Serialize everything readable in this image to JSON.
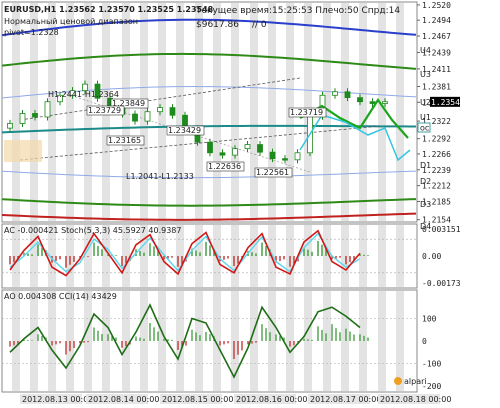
{
  "header": {
    "symbol_line": "EURUSD,H1  1.23562 1.23570 1.23525 1.23548",
    "subtitle_1": "Нормальный ценовой диапазон",
    "subtitle_2": "pivot=1.2328",
    "server_time": "Текущее время:15:25:53 Плечо:50 Спрд:14",
    "balance": "$9617.86",
    "slash_zero": "// 0"
  },
  "chart_data": [
    {
      "type": "line",
      "panel": "price",
      "y_ticks": [
        "1.2520",
        "1.2494",
        "1.2467",
        "1.2439",
        "1.2411",
        "1.2381",
        "1.2354",
        "1.2322",
        "1.2292",
        "1.2266",
        "1.2239",
        "1.2212",
        "1.2185",
        "1.2154"
      ],
      "current_price": "1.23548",
      "levels": [
        {
          "name": "U4",
          "value": 1.2494
        },
        {
          "name": "U3",
          "value": 1.2462
        },
        {
          "name": "U2",
          "value": 1.2415
        },
        {
          "name": "U1",
          "value": 1.237
        },
        {
          "name": "OC",
          "value": 1.235
        },
        {
          "name": "D1",
          "value": 1.2312
        },
        {
          "name": "D2",
          "value": 1.2285
        },
        {
          "name": "D3",
          "value": 1.2228
        },
        {
          "name": "D4",
          "value": 1.2199
        }
      ],
      "labels": [
        {
          "text": "H1.2441-H1.2364"
        },
        {
          "text": "L1.2041-L1.2133"
        },
        {
          "text": "1.23849"
        },
        {
          "text": "1.23729"
        },
        {
          "text": "1.23429"
        },
        {
          "text": "1.23165"
        },
        {
          "text": "1.22636"
        },
        {
          "text": "1.22561"
        },
        {
          "text": "1.23719"
        }
      ],
      "close_series": [
        1.2318,
        1.2335,
        1.2329,
        1.2355,
        1.2366,
        1.2374,
        1.2385,
        1.2361,
        1.2348,
        1.2334,
        1.2322,
        1.2338,
        1.2345,
        1.2332,
        1.2309,
        1.2286,
        1.2268,
        1.2264,
        1.2275,
        1.2282,
        1.2269,
        1.2258,
        1.2256,
        1.2268,
        1.233,
        1.2366,
        1.2372,
        1.2362,
        1.2355,
        1.2352,
        1.2355
      ]
    },
    {
      "type": "line",
      "panel": "stochastic",
      "legend": "AC -0.000421  Stoch(5,3,3) 45.5927 40.9387",
      "y_ticks": [
        "0.003151",
        "0.00",
        "-0.00173"
      ],
      "main": [
        25,
        60,
        85,
        30,
        15,
        45,
        90,
        55,
        20,
        70,
        88,
        40,
        18,
        72,
        92,
        35,
        20,
        65,
        90,
        30,
        18,
        75,
        95,
        40,
        25,
        55
      ],
      "signal": [
        30,
        50,
        75,
        45,
        22,
        38,
        80,
        62,
        28,
        55,
        82,
        52,
        24,
        60,
        85,
        45,
        24,
        55,
        84,
        40,
        22,
        65,
        90,
        50,
        30,
        45
      ]
    },
    {
      "type": "line",
      "panel": "cci",
      "legend": "AO 0.004308  CCI(14) 43429",
      "y_ticks": [
        "100",
        "0",
        "-100",
        "-200"
      ],
      "cci": [
        -50,
        10,
        60,
        -40,
        -120,
        -20,
        120,
        60,
        -60,
        40,
        160,
        20,
        -80,
        100,
        80,
        -40,
        -160,
        -30,
        150,
        60,
        -50,
        20,
        130,
        150,
        110,
        60
      ]
    }
  ],
  "x_axis": [
    "2012.08.13 00:00",
    "2012.08.14 00:00",
    "2012.08.15 00:00",
    "2012.08.16 00:00",
    "2012.08.17 00:00",
    "2012.08.18 00:00"
  ],
  "watermark": "alpari",
  "colors": {
    "grid": "#c8c8c8",
    "band_gray": "#d9d9d9",
    "candle_up": "#1d8a1d",
    "candle_down": "#1d8a1d",
    "blue_band": "#2a3fcc",
    "green_band": "#2e8a16",
    "red_band": "#c0201e",
    "teal": "#1c8a8a",
    "forecast_green": "#1aa61a",
    "forecast_cyan": "#33c6e0",
    "stoch_red": "#d01818",
    "stoch_cyan": "#5ad6ec",
    "cci_green": "#1f6e17"
  }
}
